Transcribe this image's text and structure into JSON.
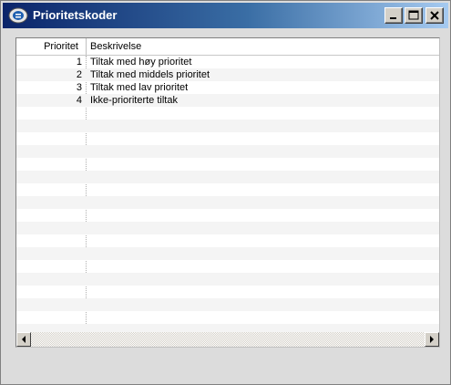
{
  "window": {
    "title": "Prioritetskoder"
  },
  "icons": {
    "app": "app-logo-icon",
    "minimize": "minimize-icon",
    "maximize": "maximize-icon",
    "close": "close-icon",
    "scroll_left": "arrow-left-icon",
    "scroll_right": "arrow-right-icon"
  },
  "table": {
    "columns": [
      "Prioritet",
      "Beskrivelse"
    ],
    "rows": [
      {
        "priority": "1",
        "description": "Tiltak med høy prioritet"
      },
      {
        "priority": "2",
        "description": "Tiltak med middels prioritet"
      },
      {
        "priority": "3",
        "description": "Tiltak med lav prioritet"
      },
      {
        "priority": "4",
        "description": "Ikke-prioriterte tiltak"
      }
    ]
  },
  "colors": {
    "titlebar_start": "#0a246a",
    "titlebar_end": "#a6caf0"
  }
}
